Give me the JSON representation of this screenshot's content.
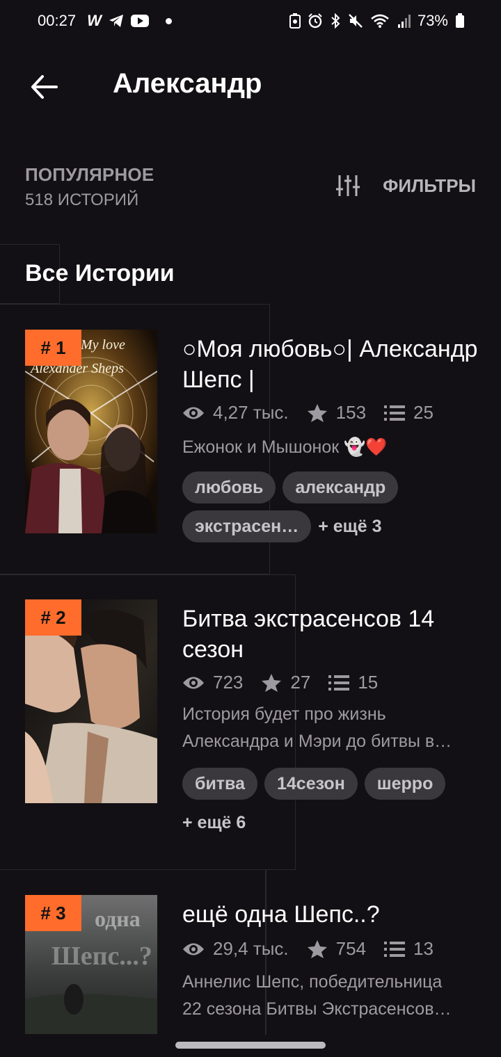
{
  "status_bar": {
    "time": "00:27",
    "battery": "73%"
  },
  "header": {
    "title": "Александр"
  },
  "sort": {
    "label": "ПОПУЛЯРНОЕ",
    "count": "518 ИСТОРИЙ",
    "filter_label": "ФИЛЬТРЫ"
  },
  "section_title": "Все Истории",
  "stories": [
    {
      "rank": "# 1",
      "title": "○Моя любовь○| Александр Шепс |",
      "views": "4,27 тыс.",
      "votes": "153",
      "parts": "25",
      "description": "Ежонок и Мышонок 👻❤️",
      "tags": [
        "любовь",
        "александр",
        "экстрасен…"
      ],
      "more": "+ ещё 3",
      "cover_text": "My love Alexander Sheps"
    },
    {
      "rank": "# 2",
      "title": "Битва экстрасенсов 14 сезон",
      "views": "723",
      "votes": "27",
      "parts": "15",
      "description_lines": [
        "История будет про жизнь",
        "Александра и Мэри до битвы в…"
      ],
      "tags": [
        "битва",
        "14сезон",
        "шерро"
      ],
      "more": "+ ещё 6"
    },
    {
      "rank": "# 3",
      "title": "ещё одна Шепс..?",
      "views": "29,4 тыс.",
      "votes": "754",
      "parts": "13",
      "description_lines": [
        "Аннелис Шепс, победительница",
        "22 сезона Битвы Экстрасенсов…"
      ],
      "cover_text": "одна Шепс...?"
    }
  ],
  "colors": {
    "accent": "#ff6c2c",
    "background": "#121014",
    "tag_bg": "#3a383c",
    "muted": "#9e9aa1"
  }
}
